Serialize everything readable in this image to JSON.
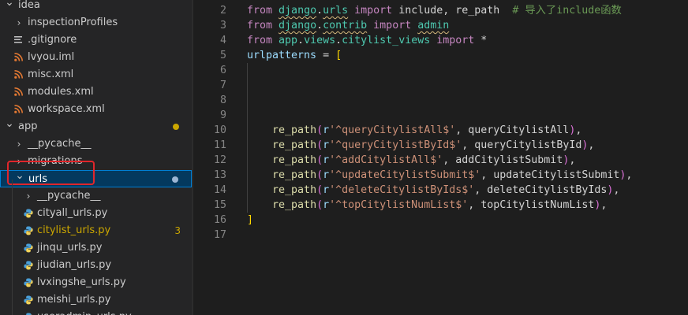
{
  "explorer": {
    "items": [
      {
        "label": "idea",
        "type": "folder-open",
        "indent": 0
      },
      {
        "label": "inspectionProfiles",
        "type": "folder",
        "indent": 1
      },
      {
        "label": ".gitignore",
        "type": "lines",
        "indent": 1
      },
      {
        "label": "lvyou.iml",
        "type": "rss",
        "indent": 1
      },
      {
        "label": "misc.xml",
        "type": "rss",
        "indent": 1
      },
      {
        "label": "modules.xml",
        "type": "rss",
        "indent": 1
      },
      {
        "label": "workspace.xml",
        "type": "rss",
        "indent": 1
      },
      {
        "label": "app",
        "type": "folder-open",
        "indent": 0,
        "dot": "#cca700"
      },
      {
        "label": "__pycache__",
        "type": "folder",
        "indent": 1
      },
      {
        "label": "migrations",
        "type": "folder",
        "indent": 1
      },
      {
        "label": "urls",
        "type": "folder-open",
        "indent": 1,
        "dot": "#9cb6d4",
        "selected": true
      },
      {
        "label": "__pycache__",
        "type": "folder",
        "indent": 2
      },
      {
        "label": "cityall_urls.py",
        "type": "python",
        "indent": 2
      },
      {
        "label": "citylist_urls.py",
        "type": "python",
        "indent": 2,
        "badge": "3",
        "modified": true
      },
      {
        "label": "jinqu_urls.py",
        "type": "python",
        "indent": 2
      },
      {
        "label": "jiudian_urls.py",
        "type": "python",
        "indent": 2
      },
      {
        "label": "lvxingshe_urls.py",
        "type": "python",
        "indent": 2
      },
      {
        "label": "meishi_urls.py",
        "type": "python",
        "indent": 2
      },
      {
        "label": "useradmin_urls.py",
        "type": "python",
        "indent": 2
      }
    ]
  },
  "editor": {
    "lines": [
      {
        "n": "2",
        "indent": 0,
        "tokens": [
          [
            "kw",
            "from"
          ],
          [
            "op",
            " "
          ],
          [
            "mod",
            "django"
          ],
          [
            "op",
            "."
          ],
          [
            "mod",
            "urls"
          ],
          [
            "op",
            " "
          ],
          [
            "kw",
            "import"
          ],
          [
            "op",
            " include, re_path  "
          ],
          [
            "cmt",
            "# 导入了include函数"
          ]
        ]
      },
      {
        "n": "3",
        "indent": 0,
        "tokens": [
          [
            "kw",
            "from"
          ],
          [
            "op",
            " "
          ],
          [
            "mod",
            "django"
          ],
          [
            "op",
            "."
          ],
          [
            "mod",
            "contrib"
          ],
          [
            "op",
            " "
          ],
          [
            "kw",
            "import"
          ],
          [
            "op",
            " "
          ],
          [
            "mod",
            "admin"
          ]
        ]
      },
      {
        "n": "4",
        "indent": 0,
        "tokens": [
          [
            "kw",
            "from"
          ],
          [
            "op",
            " "
          ],
          [
            "mod",
            "app"
          ],
          [
            "op",
            "."
          ],
          [
            "mod",
            "views"
          ],
          [
            "op",
            "."
          ],
          [
            "mod",
            "citylist_views"
          ],
          [
            "op",
            " "
          ],
          [
            "kw",
            "import"
          ],
          [
            "op",
            " *"
          ]
        ]
      },
      {
        "n": "5",
        "indent": 0,
        "tokens": [
          [
            "var",
            "urlpatterns"
          ],
          [
            "op",
            " = "
          ],
          [
            "br1",
            "["
          ]
        ]
      },
      {
        "n": "6",
        "indent": 0,
        "tokens": []
      },
      {
        "n": "7",
        "indent": 0,
        "tokens": []
      },
      {
        "n": "8",
        "indent": 0,
        "tokens": []
      },
      {
        "n": "9",
        "indent": 0,
        "tokens": []
      },
      {
        "n": "10",
        "indent": 1,
        "tokens": [
          [
            "fn",
            "re_path"
          ],
          [
            "br2",
            "("
          ],
          [
            "var",
            "r"
          ],
          [
            "str",
            "'^queryCitylistAll$'"
          ],
          [
            "op",
            ", queryCitylistAll"
          ],
          [
            "br2",
            ")"
          ],
          [
            "op",
            ","
          ]
        ]
      },
      {
        "n": "11",
        "indent": 1,
        "tokens": [
          [
            "fn",
            "re_path"
          ],
          [
            "br2",
            "("
          ],
          [
            "var",
            "r"
          ],
          [
            "str",
            "'^queryCitylistById$'"
          ],
          [
            "op",
            ", queryCitylistById"
          ],
          [
            "br2",
            ")"
          ],
          [
            "op",
            ","
          ]
        ]
      },
      {
        "n": "12",
        "indent": 1,
        "tokens": [
          [
            "fn",
            "re_path"
          ],
          [
            "br2",
            "("
          ],
          [
            "var",
            "r"
          ],
          [
            "str",
            "'^addCitylistAll$'"
          ],
          [
            "op",
            ", addCitylistSubmit"
          ],
          [
            "br2",
            ")"
          ],
          [
            "op",
            ","
          ]
        ]
      },
      {
        "n": "13",
        "indent": 1,
        "tokens": [
          [
            "fn",
            "re_path"
          ],
          [
            "br2",
            "("
          ],
          [
            "var",
            "r"
          ],
          [
            "str",
            "'^updateCitylistSubmit$'"
          ],
          [
            "op",
            ", updateCitylistSubmit"
          ],
          [
            "br2",
            ")"
          ],
          [
            "op",
            ","
          ]
        ]
      },
      {
        "n": "14",
        "indent": 1,
        "tokens": [
          [
            "fn",
            "re_path"
          ],
          [
            "br2",
            "("
          ],
          [
            "var",
            "r"
          ],
          [
            "str",
            "'^deleteCitylistByIds$'"
          ],
          [
            "op",
            ", deleteCitylistByIds"
          ],
          [
            "br2",
            ")"
          ],
          [
            "op",
            ","
          ]
        ]
      },
      {
        "n": "15",
        "indent": 1,
        "tokens": [
          [
            "fn",
            "re_path"
          ],
          [
            "br2",
            "("
          ],
          [
            "var",
            "r"
          ],
          [
            "str",
            "'^topCitylistNumList$'"
          ],
          [
            "op",
            ", topCitylistNumList"
          ],
          [
            "br2",
            ")"
          ],
          [
            "op",
            ","
          ]
        ]
      },
      {
        "n": "16",
        "indent": 0,
        "tokens": [
          [
            "br1",
            "]"
          ]
        ]
      },
      {
        "n": "17",
        "indent": 0,
        "tokens": []
      }
    ]
  },
  "colors": {
    "selection_bg": "#04395e",
    "highlight_box": "#e0262b",
    "modified": "#cca700",
    "python_icon": "#4a9fd8",
    "rss_icon": "#e37933"
  }
}
